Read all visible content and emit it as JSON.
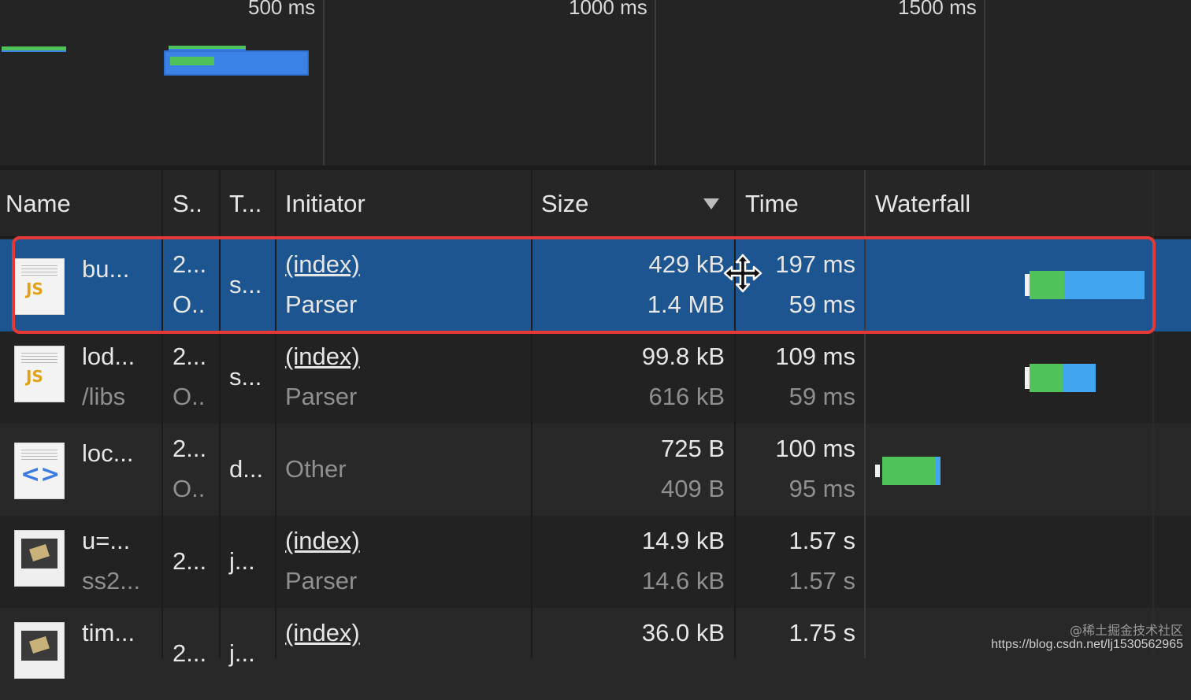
{
  "overview": {
    "ticks": [
      "500 ms",
      "1000 ms",
      "1500 ms"
    ]
  },
  "columns": {
    "name": "Name",
    "status": "S..",
    "type": "T...",
    "initiator": "Initiator",
    "size": "Size",
    "time": "Time",
    "waterfall": "Waterfall"
  },
  "rows": [
    {
      "icon": "js-file-icon",
      "name": "bu...",
      "path": "",
      "status": "2...",
      "status2": "O..",
      "type": "s...",
      "initiator": "(index)",
      "initiator_sub": "Parser",
      "size": "429 kB",
      "resource": "1.4 MB",
      "time": "197 ms",
      "latency": "59 ms"
    },
    {
      "icon": "js-file-icon",
      "name": "lod...",
      "path": "/libs",
      "status": "2...",
      "status2": "O..",
      "type": "s...",
      "initiator": "(index)",
      "initiator_sub": "Parser",
      "size": "99.8 kB",
      "resource": "616 kB",
      "time": "109 ms",
      "latency": "59 ms"
    },
    {
      "icon": "document-icon",
      "name": "loc...",
      "path": "",
      "status": "2...",
      "status2": "O..",
      "type": "d...",
      "initiator": "",
      "initiator_sub": "Other",
      "size": "725 B",
      "resource": "409 B",
      "time": "100 ms",
      "latency": "95 ms"
    },
    {
      "icon": "image-file-icon",
      "name": "u=...",
      "path": "ss2...",
      "status": "2...",
      "status2": "",
      "type": "j...",
      "initiator": "(index)",
      "initiator_sub": "Parser",
      "size": "14.9 kB",
      "resource": "14.6 kB",
      "time": "1.57 s",
      "latency": "1.57 s"
    },
    {
      "icon": "image-file-icon",
      "name": "tim...",
      "path": "",
      "status": "2...",
      "status2": "",
      "type": "j...",
      "initiator": "(index)",
      "initiator_sub": "",
      "size": "36.0 kB",
      "resource": "",
      "time": "1.75 s",
      "latency": ""
    }
  ],
  "colors": {
    "selected_row": "#1d5591",
    "highlight_box": "#e53935",
    "waterfall_waiting": "#4fc25a",
    "waterfall_download": "#42a5f0"
  },
  "watermark": {
    "line1": "@稀土掘金技术社区",
    "line2": "https://blog.csdn.net/lj1530562965"
  }
}
